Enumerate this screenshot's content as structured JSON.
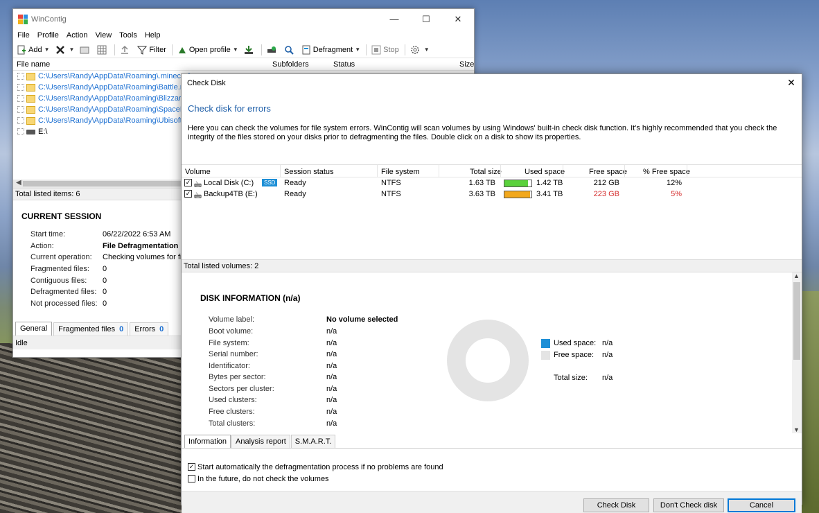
{
  "main_window": {
    "title": "WinContig",
    "menu": [
      "File",
      "Profile",
      "Action",
      "View",
      "Tools",
      "Help"
    ],
    "toolbar": {
      "add": "Add",
      "filter": "Filter",
      "open_profile": "Open profile",
      "defragment": "Defragment",
      "stop": "Stop"
    },
    "columns": [
      "File name",
      "Subfolders",
      "Status",
      "Size"
    ],
    "files": [
      "C:\\Users\\Randy\\AppData\\Roaming\\.minecraft",
      "C:\\Users\\Randy\\AppData\\Roaming\\Battle.net",
      "C:\\Users\\Randy\\AppData\\Roaming\\Blizzard",
      "C:\\Users\\Randy\\AppData\\Roaming\\SpaceEngi",
      "C:\\Users\\Randy\\AppData\\Roaming\\Ubisoft",
      "E:\\"
    ],
    "total_items": "Total listed items: 6",
    "session": {
      "heading": "CURRENT SESSION",
      "rows": [
        {
          "k": "Start time:",
          "v": "06/22/2022 6:53 AM"
        },
        {
          "k": "Action:",
          "v": "File Defragmentation"
        },
        {
          "k": "Current operation:",
          "v": "Checking volumes for file"
        },
        {
          "k": "Fragmented files:",
          "v": "0"
        },
        {
          "k": "Contiguous files:",
          "v": "0"
        },
        {
          "k": "Defragmented files:",
          "v": "0"
        },
        {
          "k": "Not processed files:",
          "v": "0"
        }
      ]
    },
    "tabs": [
      {
        "label": "General",
        "count": ""
      },
      {
        "label": "Fragmented files",
        "count": "0"
      },
      {
        "label": "Errors",
        "count": "0"
      }
    ],
    "status": "Idle"
  },
  "dialog": {
    "title": "Check Disk",
    "heading": "Check disk for errors",
    "description": "Here you can check the volumes for file system errors. WinContig will scan volumes by using Windows' built-in check disk function. It's highly recommended that you check the integrity of the files stored on your disks prior to defragmenting the files. Double click on a disk to show its properties.",
    "columns": [
      "Volume",
      "Session status",
      "File system",
      "Total size",
      "Used space",
      "Free space",
      "% Free space"
    ],
    "volumes": [
      {
        "name": "Local Disk (C:)",
        "badge": "SSD",
        "status": "Ready",
        "fs": "NTFS",
        "total": "1.63 TB",
        "used": "1.42 TB",
        "used_fraction": 0.87,
        "used_color": "#5ad13c",
        "free": "212 GB",
        "pct": "12%",
        "warn": false
      },
      {
        "name": "Backup4TB (E:)",
        "badge": "",
        "status": "Ready",
        "fs": "NTFS",
        "total": "3.63 TB",
        "used": "3.41 TB",
        "used_fraction": 0.94,
        "used_color": "#f2a81d",
        "free": "223 GB",
        "pct": "5%",
        "warn": true
      }
    ],
    "total_volumes": "Total listed volumes: 2",
    "disk_info": {
      "heading": "DISK INFORMATION (n/a)",
      "rows": [
        {
          "k": "Volume label:",
          "v": "No volume selected"
        },
        {
          "k": "Boot volume:",
          "v": "n/a"
        },
        {
          "k": "File system:",
          "v": "n/a"
        },
        {
          "k": "Serial number:",
          "v": "n/a"
        },
        {
          "k": "Identificator:",
          "v": "n/a"
        },
        {
          "k": "Bytes per sector:",
          "v": "n/a"
        },
        {
          "k": "Sectors per cluster:",
          "v": "n/a"
        },
        {
          "k": "Used clusters:",
          "v": "n/a"
        },
        {
          "k": "Free clusters:",
          "v": "n/a"
        },
        {
          "k": "Total clusters:",
          "v": "n/a"
        }
      ],
      "used_space_label": "Used space:",
      "used_space_value": "n/a",
      "free_space_label": "Free space:",
      "free_space_value": "n/a",
      "total_size_label": "Total size:",
      "total_size_value": "n/a",
      "used_color": "#1e8fd6",
      "free_color": "#e4e4e4"
    },
    "tabs": [
      "Information",
      "Analysis report",
      "S.M.A.R.T."
    ],
    "options": [
      {
        "label": "Start automatically the defragmentation process if no problems are found",
        "checked": true
      },
      {
        "label": "In the future, do not check the volumes",
        "checked": false
      }
    ],
    "buttons": {
      "check": "Check Disk",
      "dont_check": "Don't Check disk",
      "cancel": "Cancel"
    }
  }
}
